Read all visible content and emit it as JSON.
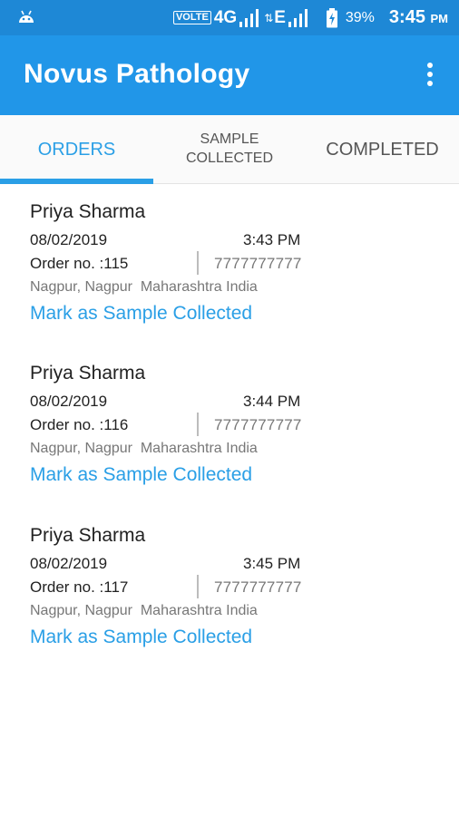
{
  "status_bar": {
    "volte": "VOLTE",
    "net1": "4G",
    "net2": "E",
    "battery": "39%",
    "time": "3:45",
    "ampm": "PM"
  },
  "app_bar": {
    "title": "Novus Pathology"
  },
  "tabs": [
    {
      "line1": "ORDERS",
      "line2": "",
      "selected": true
    },
    {
      "line1": "SAMPLE",
      "line2": "COLLECTED",
      "selected": false
    },
    {
      "line1": "COMPLETED",
      "line2": "",
      "selected": false
    }
  ],
  "orders": [
    {
      "name": "Priya Sharma",
      "date": "08/02/2019",
      "time": "3:43 PM",
      "order_no": "Order no. :115",
      "phone": "7777777777",
      "address": "Nagpur, Nagpur  Maharashtra India",
      "action": "Mark as Sample Collected"
    },
    {
      "name": "Priya Sharma",
      "date": "08/02/2019",
      "time": "3:44 PM",
      "order_no": "Order no. :116",
      "phone": "7777777777",
      "address": "Nagpur, Nagpur  Maharashtra India",
      "action": "Mark as Sample Collected"
    },
    {
      "name": "Priya Sharma",
      "date": "08/02/2019",
      "time": "3:45 PM",
      "order_no": "Order no. :117",
      "phone": "7777777777",
      "address": "Nagpur, Nagpur  Maharashtra India",
      "action": "Mark as Sample Collected"
    }
  ],
  "colors": {
    "status_bar": "#1e88d6",
    "app_bar": "#2196e8",
    "accent": "#2a9fe6"
  },
  "icons": [
    "android-icon",
    "signal-icon",
    "data-arrows-icon",
    "battery-charging-icon",
    "more-vert-icon"
  ]
}
